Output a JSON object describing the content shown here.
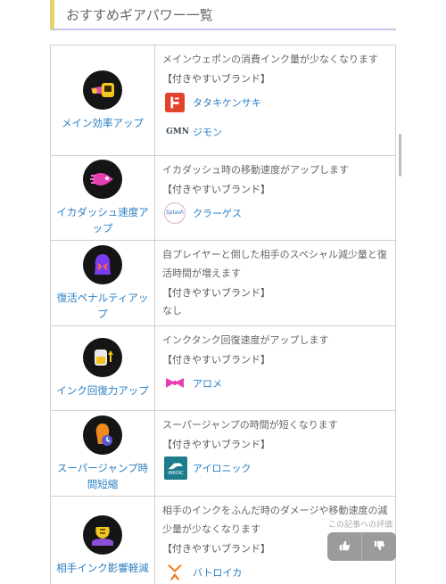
{
  "heading": "おすすめギアパワー一覧",
  "brand_heading": "【付きやすいブランド】",
  "rows": [
    {
      "name": "メイン効率アップ",
      "icon": "main-ink-saver-icon",
      "description": "メインウェポンの消費インク量が少なくなります",
      "brands": [
        {
          "name": "タタキケンサキ",
          "logo": "tentatek-logo"
        },
        {
          "name": "ジモン",
          "logo": "zink-logo",
          "logo_text": "GMN"
        }
      ]
    },
    {
      "name": "イカダッシュ速度アップ",
      "icon": "swim-speed-up-icon",
      "description": "イカダッシュ時の移動速度がアップします",
      "brands": [
        {
          "name": "クラーゲス",
          "logo": "krak-on-logo",
          "logo_text": "Splash"
        }
      ]
    },
    {
      "name": "復活ペナルティアップ",
      "icon": "respawn-punisher-icon",
      "description": "自プレイヤーと倒した相手のスペシャル減少量と復活時間が増えます",
      "brands": [],
      "none_text": "なし"
    },
    {
      "name": "インク回復力アップ",
      "icon": "ink-recovery-up-icon",
      "description": "インクタンク回復速度がアップします",
      "brands": [
        {
          "name": "アロメ",
          "logo": "rockenberg-bow-logo"
        }
      ]
    },
    {
      "name": "スーパージャンプ時間短縮",
      "icon": "quick-super-jump-icon",
      "description": "スーパージャンプの時間が短くなります",
      "brands": [
        {
          "name": "アイロニック",
          "logo": "inkline-logo",
          "logo_text": "iNROIC"
        }
      ]
    },
    {
      "name": "相手インク影響軽減",
      "icon": "ink-resistance-up-icon",
      "description": "相手のインクをふんだ時のダメージや移動速度の減少量が少なくなります",
      "brands": [
        {
          "name": "バトロイカ",
          "logo": "forge-logo"
        }
      ]
    }
  ],
  "rating": {
    "label": "この記事への評価",
    "like_icon": "thumbs-up-icon",
    "dislike_icon": "thumbs-down-icon"
  }
}
